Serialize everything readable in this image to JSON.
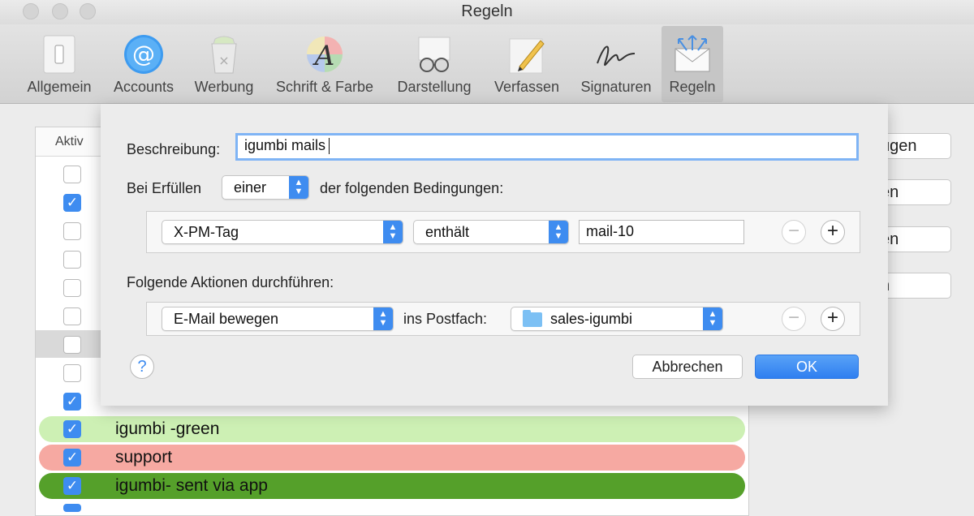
{
  "window": {
    "title": "Regeln"
  },
  "toolbar": {
    "items": [
      {
        "label": "Allgemein",
        "icon": "switch-icon"
      },
      {
        "label": "Accounts",
        "icon": "at-icon"
      },
      {
        "label": "Werbung",
        "icon": "trash-icon"
      },
      {
        "label": "Schrift & Farbe",
        "icon": "font-color-icon"
      },
      {
        "label": "Darstellung",
        "icon": "glasses-icon"
      },
      {
        "label": "Verfassen",
        "icon": "pencil-icon"
      },
      {
        "label": "Signaturen",
        "icon": "signature-icon"
      },
      {
        "label": "Regeln",
        "icon": "rules-envelope-icon"
      }
    ],
    "active": "Regeln"
  },
  "list": {
    "header_active": "Aktiv",
    "checkboxes": [
      false,
      true,
      false,
      false,
      false,
      false,
      false,
      false,
      true
    ],
    "rows": [
      {
        "name": "igumbi -green",
        "checked": true,
        "color": "#cdf0b4"
      },
      {
        "name": "support",
        "checked": true,
        "color": "#f6a9a2"
      },
      {
        "name": "igumbi- sent via app",
        "checked": true,
        "color": "#55a02a"
      }
    ]
  },
  "side_buttons": [
    "ügen",
    "en",
    "en",
    "n"
  ],
  "sheet": {
    "description_label": "Beschreibung:",
    "description_value": "igumbi mails",
    "match_prefix": "Bei Erfüllen",
    "match_mode": "einer",
    "match_suffix": "der folgenden Bedingungen:",
    "condition": {
      "field": "X-PM-Tag",
      "operator": "enthält",
      "value": "mail-10"
    },
    "actions_label": "Folgende Aktionen durchführen:",
    "action": {
      "type": "E-Mail bewegen",
      "mailbox_label": "ins Postfach:",
      "mailbox": "sales-igumbi"
    },
    "minus_symbol": "−",
    "plus_symbol": "+",
    "help_symbol": "?",
    "cancel_label": "Abbrechen",
    "ok_label": "OK"
  },
  "colors": {
    "accent": "#3e8cf0"
  }
}
